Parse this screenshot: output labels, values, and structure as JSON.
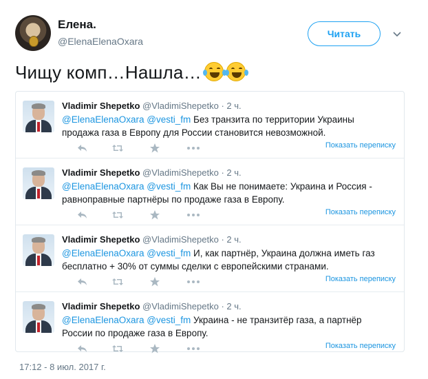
{
  "author": {
    "name": "Елена.",
    "handle": "@ElenaElenaOxara",
    "follow_label": "Читать"
  },
  "tweet": {
    "text": "Чищу комп…Нашла…",
    "emoji": [
      "face-with-tears-of-joy",
      "face-with-tears-of-joy"
    ],
    "timestamp": "17:12 - 8 июл. 2017 г."
  },
  "thread": {
    "show_thread_label": "Показать переписку",
    "items": [
      {
        "name": "Vladimir Shepetko",
        "handle": "@VladimiShepetko",
        "time": "· 2 ч.",
        "mentions": "@ElenaElenaOxara @vesti_fm",
        "text": " Без транзита по территории Украины продажа газа в Европу для России становится невозможной."
      },
      {
        "name": "Vladimir Shepetko",
        "handle": "@VladimiShepetko",
        "time": "· 2 ч.",
        "mentions": "@ElenaElenaOxara @vesti_fm",
        "text": " Как Вы не понимаете: Украина и Россия - равноправные партнёры по продаже газа в Европу."
      },
      {
        "name": "Vladimir Shepetko",
        "handle": "@VladimiShepetko",
        "time": "· 2 ч.",
        "mentions": "@ElenaElenaOxara @vesti_fm",
        "text": " И, как партнёр, Украина должна иметь газ бесплатно + 30% от суммы сделки с европейскими странами."
      },
      {
        "name": "Vladimir Shepetko",
        "handle": "@VladimiShepetko",
        "time": "· 2 ч.",
        "mentions": "@ElenaElenaOxara @vesti_fm",
        "text": " Украина - не транзитёр газа, а партнёр России по продаже газа в Европу."
      }
    ]
  },
  "colors": {
    "accent": "#1da1f2",
    "link": "#1b95e0",
    "muted": "#657786"
  }
}
